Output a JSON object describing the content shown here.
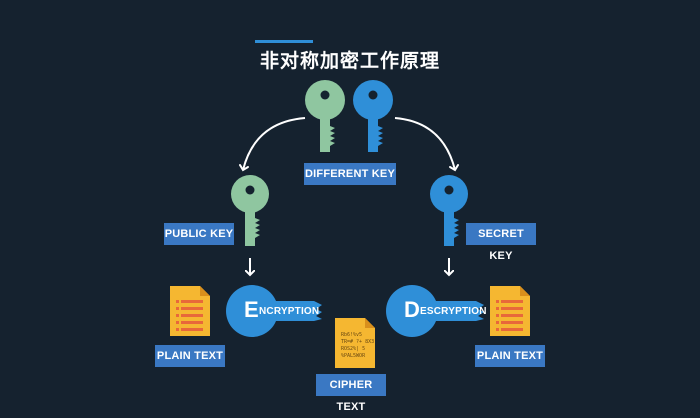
{
  "title": "非对称加密工作原理",
  "labels": {
    "different_key": "DIFFERENT KEY",
    "public_key": "PUBLIC KEY",
    "secret_key": "SECRET KEY",
    "plain_text_left": "PLAIN TEXT",
    "plain_text_right": "PLAIN TEXT",
    "cipher_text": "CIPHER TEXT"
  },
  "encryption": {
    "initial": "E",
    "rest": "NCRYPTION"
  },
  "decryption": {
    "initial": "D",
    "rest": "ESCRYPTION"
  },
  "cipher_doc": {
    "line1": "Rb6!%v5",
    "line2": "TR=# ?+ 8X3",
    "line3": "ROS2%| 5",
    "line4": "%PAL5WOR"
  },
  "colors": {
    "background": "#15222f",
    "accent": "#2f8fd8",
    "label": "#3a78c3",
    "green_key": "#8fc6a0",
    "blue_key": "#2f8fd8",
    "document": "#f5b731"
  }
}
